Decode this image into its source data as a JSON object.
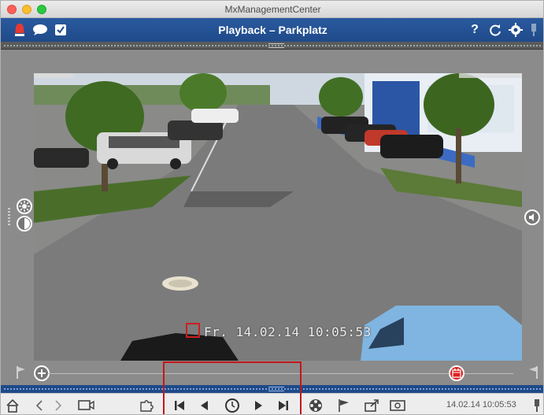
{
  "window": {
    "title": "MxManagementCenter"
  },
  "header": {
    "title": "Playback – Parkplatz",
    "left_icons": [
      "alarm-bell-icon",
      "chat-bubble-icon",
      "checkbox-icon"
    ],
    "right_icons": [
      "help-icon",
      "refresh-icon",
      "settings-gear-icon",
      "pin-icon"
    ],
    "help_label": "?"
  },
  "camera": {
    "overlay_timestamp": "Fr. 14.02.14 10:05:53",
    "left_controls": [
      "brightness-icon",
      "contrast-icon"
    ],
    "right_controls": [
      "speaker-icon"
    ]
  },
  "timeline": {
    "start_flag_icon": "start-flag-icon",
    "end_flag_icon": "end-flag-icon",
    "add_button_icon": "plus-icon",
    "calendar_icon": "calendar-icon"
  },
  "toolbar": {
    "buttons": [
      "home-icon",
      "back-icon",
      "forward-icon",
      "camera-view-icon",
      "layout-puzzle-icon",
      "skip-to-start-icon",
      "step-back-icon",
      "play-clock-icon",
      "step-forward-icon",
      "skip-to-end-icon",
      "film-reel-icon",
      "bookmark-flag-icon",
      "export-icon",
      "snapshot-icon"
    ],
    "time": "14.02.14 10:05:53",
    "pin_icon": "pin-icon"
  },
  "colors": {
    "header_blue": "#1f4a8a",
    "highlight_red": "#c4161c",
    "calendar_red": "#dd2222"
  }
}
